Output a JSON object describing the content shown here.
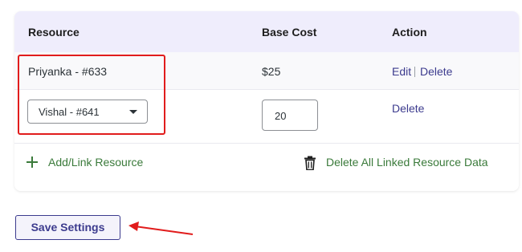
{
  "table": {
    "headers": {
      "resource": "Resource",
      "base_cost": "Base Cost",
      "action": "Action"
    },
    "rows": [
      {
        "resource": "Priyanka - #633",
        "base_cost": "$25",
        "edit": "Edit",
        "delete": "Delete"
      },
      {
        "resource_select": "Vishal - #641",
        "base_cost_input": "20",
        "delete": "Delete"
      }
    ]
  },
  "footer": {
    "add_link": "Add/Link Resource",
    "delete_all": "Delete All Linked Resource Data"
  },
  "save_button": "Save Settings",
  "icons": {
    "add": "plus-icon",
    "delete_all": "trash-icon",
    "select": "chevron-down-icon"
  },
  "colors": {
    "header_bg": "#efedfc",
    "link": "#3c3b8e",
    "green": "#3a7a3a",
    "annotation": "#e11c1c"
  }
}
